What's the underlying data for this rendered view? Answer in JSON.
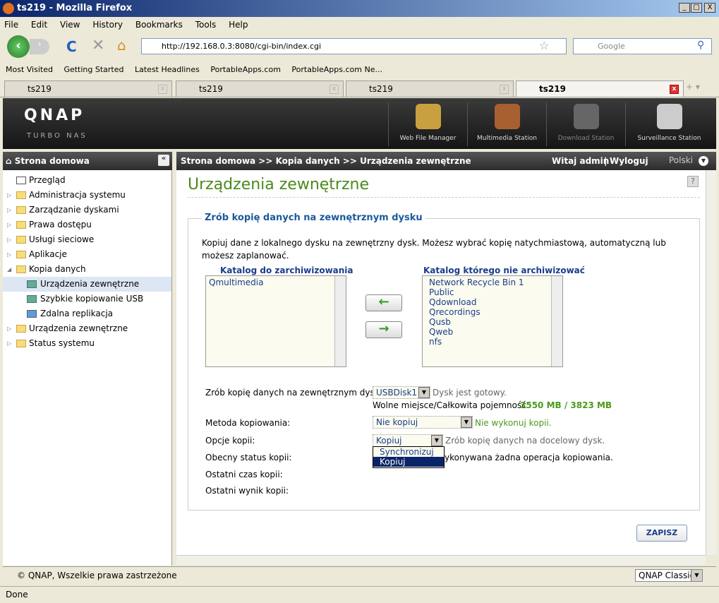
{
  "browser": {
    "title": "ts219 - Mozilla Firefox",
    "menu": [
      "File",
      "Edit",
      "View",
      "History",
      "Bookmarks",
      "Tools",
      "Help"
    ],
    "url": "http://192.168.0.3:8080/cgi-bin/index.cgi",
    "search_placeholder": "Google",
    "bookmarks": [
      "Most Visited",
      "Getting Started",
      "Latest Headlines",
      "PortableApps.com",
      "PortableApps.com Ne..."
    ],
    "tabs": [
      "ts219",
      "ts219",
      "ts219",
      "ts219"
    ],
    "status": "Done"
  },
  "header": {
    "logo": "QNAP",
    "sublogo": "TURBO NAS",
    "apps": [
      "Web File Manager",
      "Multimedia Station",
      "Download Station",
      "Surveillance Station"
    ]
  },
  "sidebar": {
    "title": "Strona domowa",
    "items": [
      {
        "label": "Przegląd",
        "type": "page"
      },
      {
        "label": "Administracja systemu",
        "type": "folder"
      },
      {
        "label": "Zarządzanie dyskami",
        "type": "folder"
      },
      {
        "label": "Prawa dostępu",
        "type": "folder"
      },
      {
        "label": "Usługi sieciowe",
        "type": "folder"
      },
      {
        "label": "Aplikacje",
        "type": "folder"
      },
      {
        "label": "Kopia danych",
        "type": "folder-open"
      },
      {
        "label": "Urządzenia zewnętrzne",
        "type": "sub",
        "selected": true
      },
      {
        "label": "Szybkie kopiowanie USB",
        "type": "sub"
      },
      {
        "label": "Zdalna replikacja",
        "type": "sub"
      },
      {
        "label": "Urządzenia zewnętrzne",
        "type": "folder"
      },
      {
        "label": "Status systemu",
        "type": "folder"
      }
    ]
  },
  "topbar": {
    "breadcrumb": "Strona domowa >> Kopia danych >> Urządzenia zewnętrzne",
    "welcome": "Witaj admin",
    "logout": "Wyloguj",
    "language": "Polski"
  },
  "main": {
    "title": "Urządzenia zewnętrzne",
    "section": "Zrób kopię danych na zewnętrznym dysku",
    "description": "Kopiuj dane z lokalnego dysku na zewnętrzny dysk. Możesz wybrać kopię natychmiastową, automatyczną lub możesz zaplanować.",
    "include_label": "Katalog do zarchiwizowania",
    "include_items": [
      "Qmultimedia"
    ],
    "exclude_label": "Katalog którego nie archiwizować",
    "exclude_items": [
      "Network Recycle Bin 1",
      "Public",
      "Qdownload",
      "Qrecordings",
      "Qusb",
      "Qweb",
      "nfs"
    ],
    "disk_label": "Zrób kopię danych na zewnętrznym dysku:",
    "disk_value": "USBDisk1",
    "disk_status": "Dysk jest gotowy.",
    "space_label": "Wolne miejsce/Całkowita pojemność:",
    "space_value": "3550 MB / 3823 MB",
    "method_label": "Metoda kopiowania:",
    "method_value": "Nie kopiuj",
    "method_hint": "Nie wykonuj kopii.",
    "options_label": "Opcje kopii:",
    "options_value": "Kopiuj",
    "options_hint": "Zrób kopię danych na docelowy dysk.",
    "options_dropdown": [
      "Synchronizuj",
      "Kopiuj"
    ],
    "status_label": "Obecny status kopii:",
    "status_value": "ykonywana żadna operacja kopiowania.",
    "last_time_label": "Ostatni czas kopii:",
    "last_result_label": "Ostatni wynik kopii:",
    "save": "ZAPISZ"
  },
  "footer": {
    "copyright": "© QNAP, Wszelkie prawa zastrzeżone",
    "theme": "QNAP Classic"
  }
}
